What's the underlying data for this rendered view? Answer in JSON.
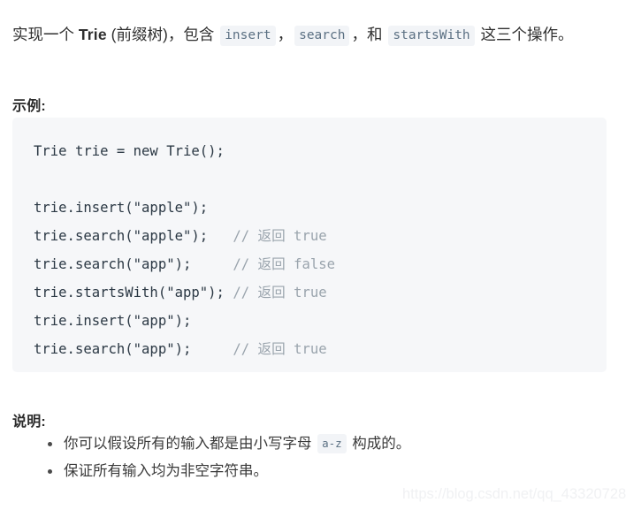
{
  "document": {
    "intro": {
      "part1": "实现一个 ",
      "latin": "Trie",
      "part2": " (前缀树)，包含 ",
      "code1": "insert",
      "sep1": "，",
      "code2": "search",
      "sep2": "，和 ",
      "code3": "startsWith",
      "part3": " 这三个操作。"
    },
    "example_heading": "示例:",
    "code_block": {
      "language": "java",
      "lines": [
        {
          "text": "Trie trie = new Trie();",
          "comment": ""
        },
        {
          "text": "",
          "comment": ""
        },
        {
          "text": "trie.insert(\"apple\");",
          "comment": ""
        },
        {
          "text": "trie.search(\"apple\");",
          "comment": "   // 返回 true"
        },
        {
          "text": "trie.search(\"app\");",
          "comment": "     // 返回 false"
        },
        {
          "text": "trie.startsWith(\"app\");",
          "comment": " // 返回 true"
        },
        {
          "text": "trie.insert(\"app\");",
          "comment": ""
        },
        {
          "text": "trie.search(\"app\");",
          "comment": "     // 返回 true"
        }
      ],
      "raw": [
        "Trie trie = new Trie();",
        "",
        "trie.insert(\"apple\");",
        "trie.search(\"apple\");    // 返回 true",
        "trie.search(\"app\");      // 返回 false",
        "trie.startsWith(\"app\");  // 返回 true",
        "trie.insert(\"app\");",
        "trie.search(\"app\");      // 返回 true"
      ]
    },
    "notes_heading": "说明:",
    "notes": [
      {
        "prefix": "你可以假设所有的输入都是由小写字母 ",
        "code": "a-z",
        "suffix": " 构成的。"
      },
      {
        "prefix": "保证所有输入均为非空字符串。",
        "code": "",
        "suffix": ""
      }
    ],
    "watermark": "https://blog.csdn.net/qq_43320728"
  },
  "colors": {
    "text": "#2f2f2f",
    "inline_code_text": "#5b7083",
    "inline_code_bg": "#f2f4f7",
    "code_block_bg": "#f6f7f9",
    "code_block_text": "#2b3844",
    "comment": "#9aa4ad",
    "watermark": "#f0f1f3"
  }
}
